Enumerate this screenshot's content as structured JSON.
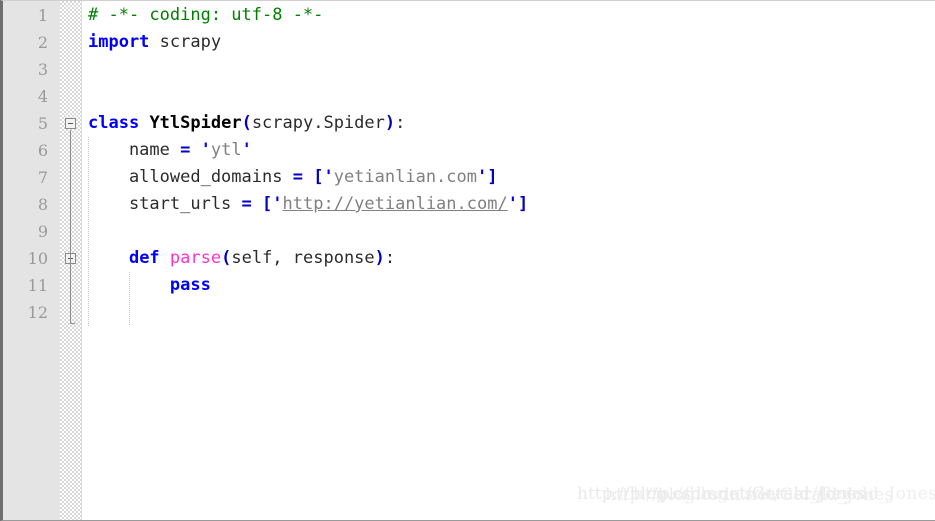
{
  "editor": {
    "language": "Python",
    "line_count": 12,
    "current_line": 1,
    "gutter_line_numbers": [
      "1",
      "2",
      "3",
      "4",
      "5",
      "6",
      "7",
      "8",
      "9",
      "10",
      "11",
      "12"
    ],
    "colors": {
      "gutter_background": "#e4e4e4",
      "code_background": "#ffffff",
      "current_line_highlight": "#e8e8fa",
      "line_number": "#999999",
      "keyword": "#0000ff",
      "comment": "#008000",
      "string": "#808080",
      "function_name": "#ff33cc",
      "bracket": "#0000c0",
      "text": "#2b2b2b"
    }
  },
  "code": {
    "lines": [
      {
        "number": "1",
        "indent": 0,
        "fold": "none",
        "tokens": [
          {
            "text": "# -*- coding: utf-8 -*-",
            "type": "cmt"
          }
        ]
      },
      {
        "number": "2",
        "indent": 0,
        "fold": "none",
        "tokens": [
          {
            "text": "import",
            "type": "kw"
          },
          {
            "text": " scrapy",
            "type": "plain"
          }
        ]
      },
      {
        "number": "3",
        "indent": 0,
        "fold": "none",
        "tokens": []
      },
      {
        "number": "4",
        "indent": 0,
        "fold": "none",
        "tokens": []
      },
      {
        "number": "5",
        "indent": 0,
        "fold": "open",
        "tokens": [
          {
            "text": "class",
            "type": "kw"
          },
          {
            "text": " ",
            "type": "plain"
          },
          {
            "text": "YtlSpider",
            "type": "cls"
          },
          {
            "text": "(",
            "type": "brk"
          },
          {
            "text": "scrapy.Spider",
            "type": "plain"
          },
          {
            "text": ")",
            "type": "brk"
          },
          {
            "text": ":",
            "type": "plain"
          }
        ]
      },
      {
        "number": "6",
        "indent": 1,
        "fold": "none",
        "tokens": [
          {
            "text": "    name ",
            "type": "plain"
          },
          {
            "text": "=",
            "type": "op"
          },
          {
            "text": " ",
            "type": "plain"
          },
          {
            "text": "'",
            "type": "quo"
          },
          {
            "text": "ytl",
            "type": "str"
          },
          {
            "text": "'",
            "type": "quo"
          }
        ]
      },
      {
        "number": "7",
        "indent": 1,
        "fold": "none",
        "tokens": [
          {
            "text": "    allowed_domains ",
            "type": "plain"
          },
          {
            "text": "=",
            "type": "op"
          },
          {
            "text": " ",
            "type": "plain"
          },
          {
            "text": "[",
            "type": "brk"
          },
          {
            "text": "'",
            "type": "quo"
          },
          {
            "text": "yetianlian.com",
            "type": "str"
          },
          {
            "text": "'",
            "type": "quo"
          },
          {
            "text": "]",
            "type": "brk"
          }
        ]
      },
      {
        "number": "8",
        "indent": 1,
        "fold": "none",
        "tokens": [
          {
            "text": "    start_urls ",
            "type": "plain"
          },
          {
            "text": "=",
            "type": "op"
          },
          {
            "text": " ",
            "type": "plain"
          },
          {
            "text": "[",
            "type": "brk"
          },
          {
            "text": "'",
            "type": "quo"
          },
          {
            "text": "http://yetianlian.com/",
            "type": "url"
          },
          {
            "text": "'",
            "type": "quo"
          },
          {
            "text": "]",
            "type": "brk"
          }
        ]
      },
      {
        "number": "9",
        "indent": 1,
        "fold": "none",
        "tokens": []
      },
      {
        "number": "10",
        "indent": 1,
        "fold": "open",
        "tokens": [
          {
            "text": "    ",
            "type": "plain"
          },
          {
            "text": "def",
            "type": "kw"
          },
          {
            "text": " ",
            "type": "plain"
          },
          {
            "text": "parse",
            "type": "fn"
          },
          {
            "text": "(",
            "type": "brk"
          },
          {
            "text": "self, response",
            "type": "plain"
          },
          {
            "text": ")",
            "type": "brk"
          },
          {
            "text": ":",
            "type": "plain"
          }
        ]
      },
      {
        "number": "11",
        "indent": 2,
        "fold": "none",
        "tokens": [
          {
            "text": "        ",
            "type": "plain"
          },
          {
            "text": "pass",
            "type": "kw"
          }
        ]
      },
      {
        "number": "12",
        "indent": 1,
        "fold": "none",
        "tokens": []
      }
    ]
  },
  "watermark": {
    "text": "http://blog.csdn.net/Gerald_Jones"
  }
}
